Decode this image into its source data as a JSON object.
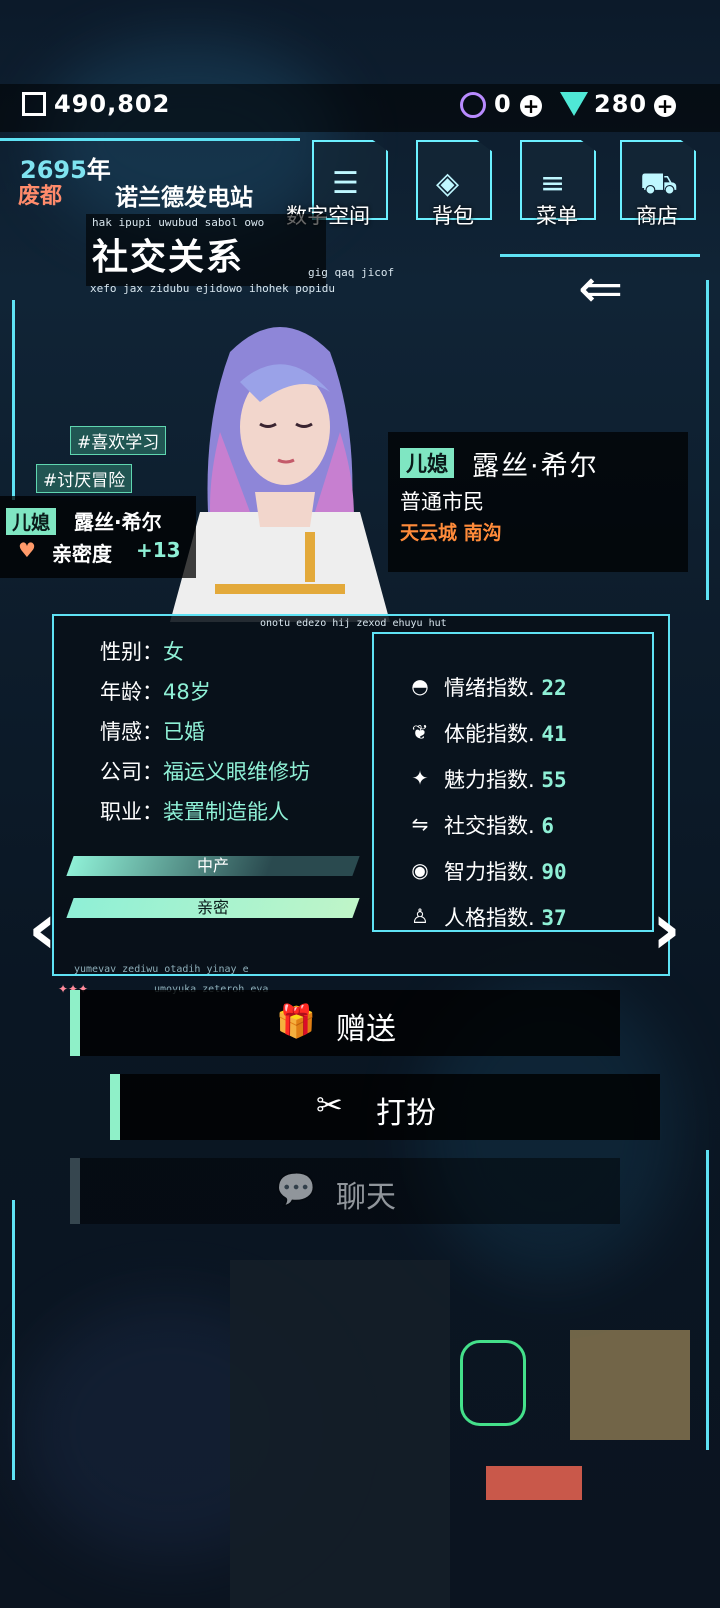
{
  "currency": {
    "coins": "490,802",
    "gems_a": "0",
    "gems_b": "280"
  },
  "header": {
    "year_num": "2695",
    "year_unit": "年",
    "city": "废都",
    "station": "诺兰德发电站",
    "nav": [
      "数字空间",
      "背包",
      "菜单",
      "商店"
    ],
    "title": "社交关系",
    "glitch_top": "hak ipupi uwubud sabol owo",
    "glitch_bottom": "xefo jax zidubu ejidowo ihohek popidu",
    "glitch_right": "gig qaq jicof"
  },
  "tags": [
    "#喜欢学习",
    "#讨厌冒险"
  ],
  "name_card": {
    "relation": "儿媳",
    "name": "露丝·希尔",
    "intimacy_label": "亲密度",
    "intimacy_value": "+13"
  },
  "info_card": {
    "relation": "儿媳",
    "name": "露丝·希尔",
    "class": "普通市民",
    "location": "天云城 南沟"
  },
  "profile": {
    "glitch": "onotu edezo hij zexod ehuyu hut",
    "rows": [
      {
        "label": "性别：",
        "value": "女"
      },
      {
        "label": "年龄：",
        "value": "48岁"
      },
      {
        "label": "情感：",
        "value": "已婚"
      },
      {
        "label": "公司：",
        "value": "福运义眼维修坊"
      },
      {
        "label": "职业：",
        "value": "装置制造能人"
      }
    ],
    "bars": [
      "中产",
      "亲密"
    ],
    "footer_1": "yumevav zediwu otadih yinay e",
    "footer_2": "umoyuka zeteroh eva",
    "stars": "✦✦✦"
  },
  "stats": [
    {
      "label": "情绪指数.",
      "value": "22",
      "icon": "mood-icon"
    },
    {
      "label": "体能指数.",
      "value": "41",
      "icon": "stamina-icon"
    },
    {
      "label": "魅力指数.",
      "value": "55",
      "icon": "charm-icon"
    },
    {
      "label": "社交指数.",
      "value": "6",
      "icon": "social-icon"
    },
    {
      "label": "智力指数.",
      "value": "90",
      "icon": "intellect-icon"
    },
    {
      "label": "人格指数.",
      "value": "37",
      "icon": "personality-icon"
    }
  ],
  "actions": {
    "gift": "赠送",
    "dress": "打扮",
    "chat": "聊天"
  },
  "colors": {
    "accent": "#5fe2f4",
    "mint": "#8ff0d6",
    "city": "#ff8b6b"
  }
}
